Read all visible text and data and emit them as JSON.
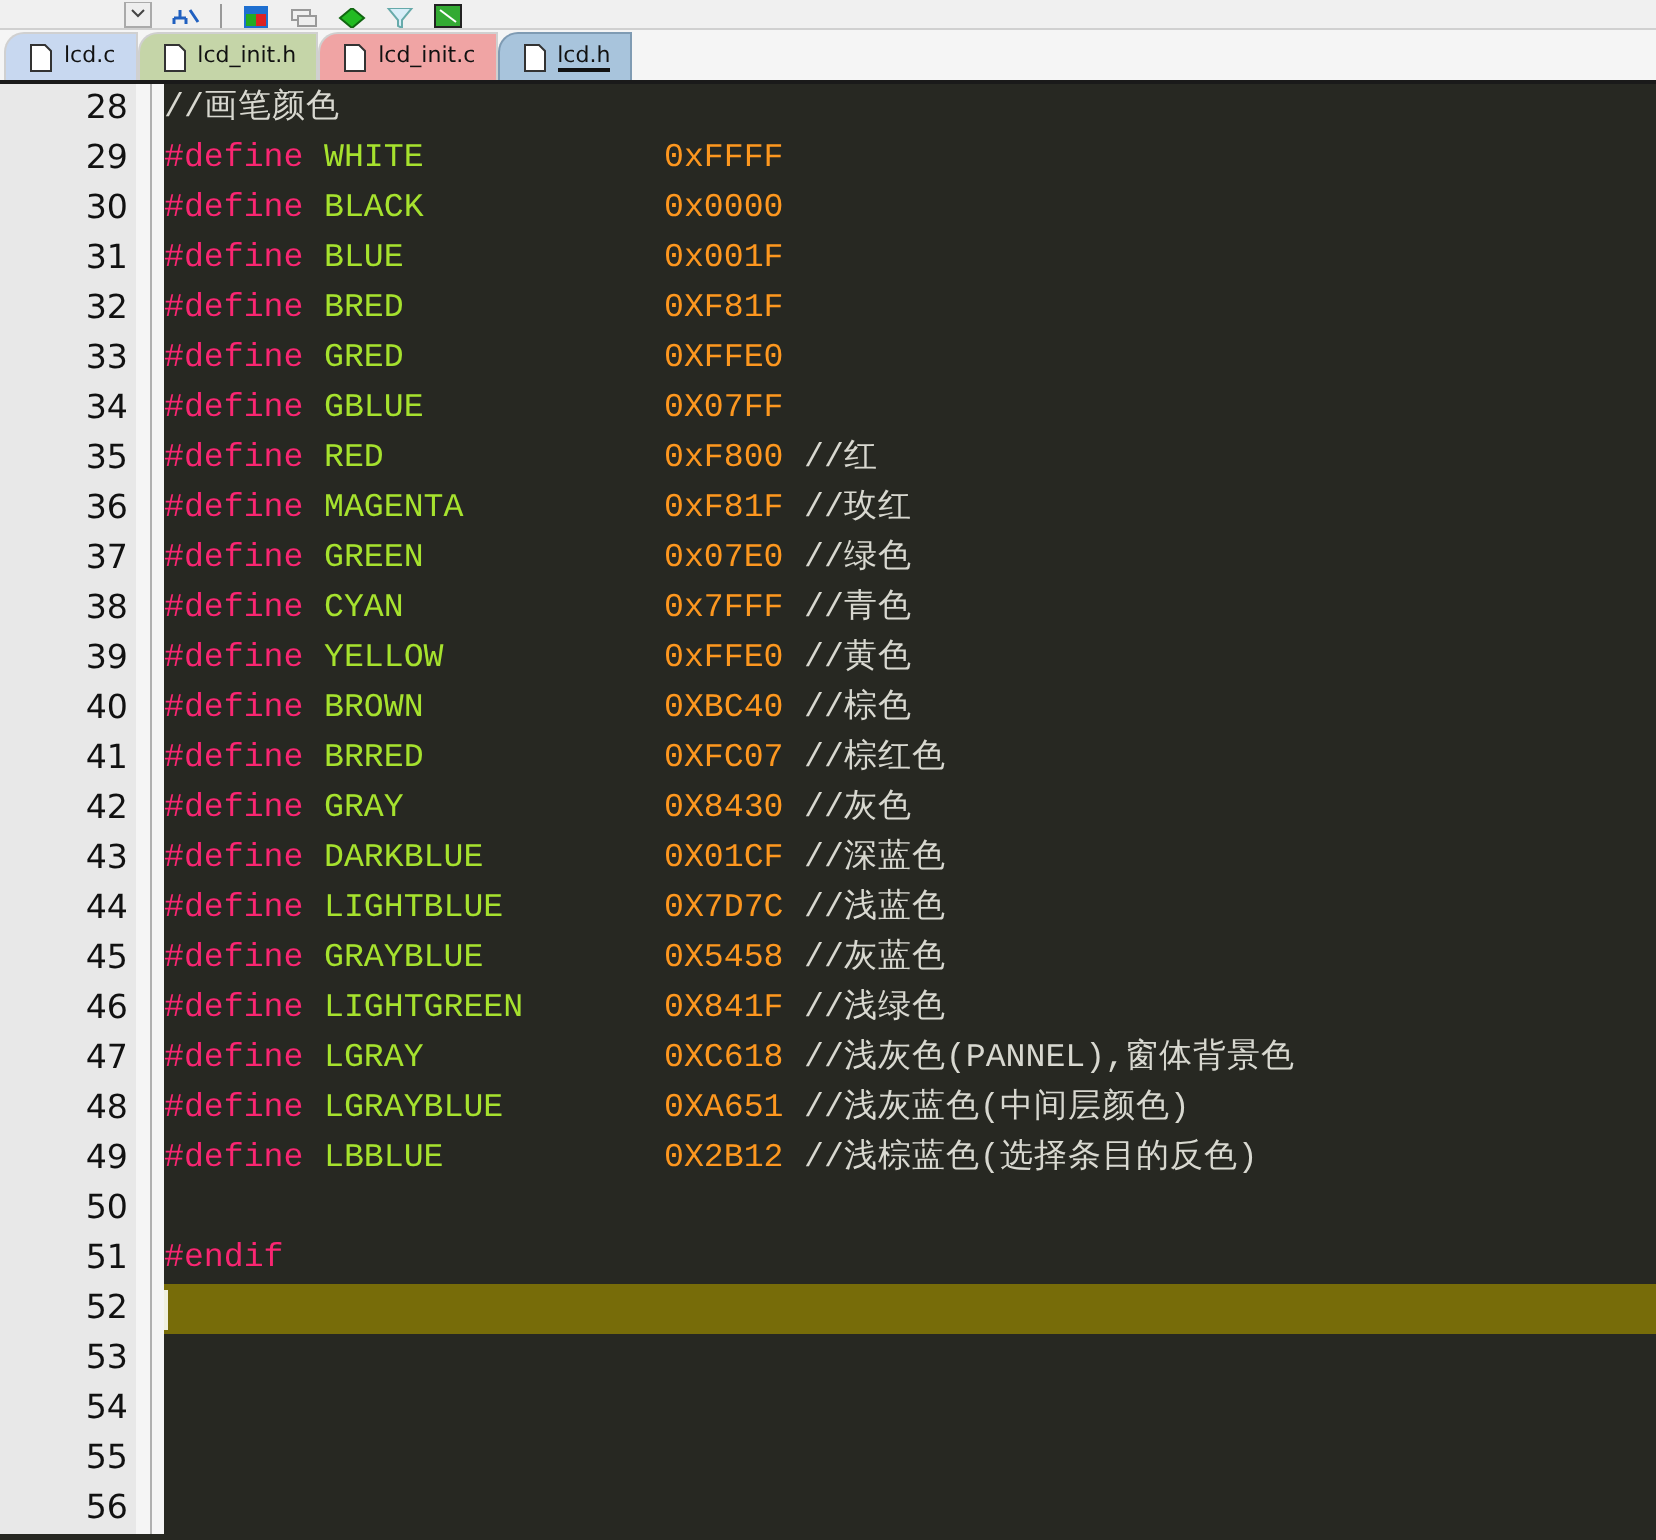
{
  "tabs": [
    {
      "label": "lcd.c",
      "selected": false,
      "color": "#c8d8f0"
    },
    {
      "label": "lcd_init.h",
      "selected": false,
      "color": "#c5d5a8"
    },
    {
      "label": "lcd_init.c",
      "selected": false,
      "color": "#f0a4a4"
    },
    {
      "label": "lcd.h",
      "selected": true,
      "color": "#a8c4dc"
    }
  ],
  "lines": [
    {
      "number": "28",
      "kind": "comment",
      "text": "//画笔颜色",
      "selected": false
    },
    {
      "number": "29",
      "kind": "define",
      "keyword": "#define",
      "name": "WHITE",
      "value": "0xFFFF",
      "selected": false
    },
    {
      "number": "30",
      "kind": "define",
      "keyword": "#define",
      "name": "BLACK",
      "value": "0x0000",
      "selected": false
    },
    {
      "number": "31",
      "kind": "define",
      "keyword": "#define",
      "name": "BLUE",
      "value": "0x001F",
      "selected": false
    },
    {
      "number": "32",
      "kind": "define",
      "keyword": "#define",
      "name": "BRED",
      "value": "0XF81F",
      "selected": false
    },
    {
      "number": "33",
      "kind": "define",
      "keyword": "#define",
      "name": "GRED",
      "value": "0XFFE0",
      "selected": false
    },
    {
      "number": "34",
      "kind": "define",
      "keyword": "#define",
      "name": "GBLUE",
      "value": "0X07FF",
      "selected": false
    },
    {
      "number": "35",
      "kind": "define",
      "keyword": "#define",
      "name": "RED",
      "value": "0xF800",
      "comment": "//红",
      "selected": false
    },
    {
      "number": "36",
      "kind": "define",
      "keyword": "#define",
      "name": "MAGENTA",
      "value": "0xF81F",
      "comment": "//玫红",
      "selected": false
    },
    {
      "number": "37",
      "kind": "define",
      "keyword": "#define",
      "name": "GREEN",
      "value": "0x07E0",
      "comment": "//绿色",
      "selected": false
    },
    {
      "number": "38",
      "kind": "define",
      "keyword": "#define",
      "name": "CYAN",
      "value": "0x7FFF",
      "comment": "//青色",
      "selected": false
    },
    {
      "number": "39",
      "kind": "define",
      "keyword": "#define",
      "name": "YELLOW",
      "value": "0xFFE0",
      "comment": "//黄色",
      "selected": false
    },
    {
      "number": "40",
      "kind": "define",
      "keyword": "#define",
      "name": "BROWN",
      "value": "0XBC40",
      "comment": "//棕色",
      "selected": false
    },
    {
      "number": "41",
      "kind": "define",
      "keyword": "#define",
      "name": "BRRED",
      "value": "0XFC07",
      "comment": "//棕红色",
      "selected": false
    },
    {
      "number": "42",
      "kind": "define",
      "keyword": "#define",
      "name": "GRAY",
      "value": "0X8430",
      "comment": "//灰色",
      "selected": false
    },
    {
      "number": "43",
      "kind": "define",
      "keyword": "#define",
      "name": "DARKBLUE",
      "value": "0X01CF",
      "comment": "//深蓝色",
      "selected": false
    },
    {
      "number": "44",
      "kind": "define",
      "keyword": "#define",
      "name": "LIGHTBLUE",
      "value": "0X7D7C",
      "comment": "//浅蓝色",
      "selected": false
    },
    {
      "number": "45",
      "kind": "define",
      "keyword": "#define",
      "name": "GRAYBLUE",
      "value": "0X5458",
      "comment": "//灰蓝色",
      "selected": false
    },
    {
      "number": "46",
      "kind": "define",
      "keyword": "#define",
      "name": "LIGHTGREEN",
      "value": "0X841F",
      "comment": "//浅绿色",
      "selected": false
    },
    {
      "number": "47",
      "kind": "define",
      "keyword": "#define",
      "name": "LGRAY",
      "value": "0XC618",
      "comment": "//浅灰色(PANNEL),窗体背景色",
      "selected": false
    },
    {
      "number": "48",
      "kind": "define",
      "keyword": "#define",
      "name": "LGRAYBLUE",
      "value": "0XA651",
      "comment": "//浅灰蓝色(中间层颜色)",
      "selected": false
    },
    {
      "number": "49",
      "kind": "define",
      "keyword": "#define",
      "name": "LBBLUE",
      "value": "0X2B12",
      "comment": "//浅棕蓝色(选择条目的反色)",
      "selected": false
    },
    {
      "number": "50",
      "kind": "blank",
      "selected": false
    },
    {
      "number": "51",
      "kind": "directive",
      "text": "#endif",
      "selected": false
    },
    {
      "number": "52",
      "kind": "blank",
      "selected": true
    },
    {
      "number": "53",
      "kind": "blank",
      "selected": false
    },
    {
      "number": "54",
      "kind": "blank",
      "selected": false
    },
    {
      "number": "55",
      "kind": "blank",
      "selected": false
    },
    {
      "number": "56",
      "kind": "blank",
      "selected": false
    }
  ]
}
